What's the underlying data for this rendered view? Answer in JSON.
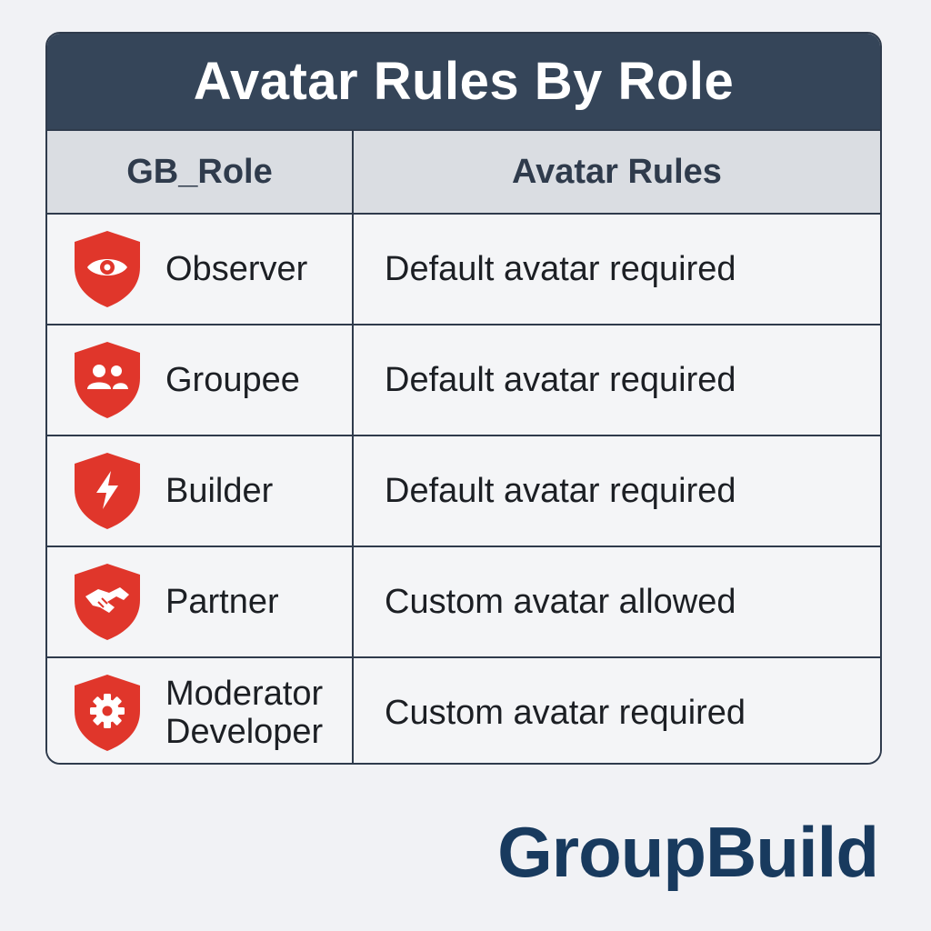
{
  "title": "Avatar Rules By Role",
  "columns": [
    "GB_Role",
    "Avatar Rules"
  ],
  "rows": [
    {
      "role": "Observer",
      "rule": "Default avatar required",
      "icon": "eye-icon"
    },
    {
      "role": "Groupee",
      "rule": "Default avatar required",
      "icon": "people-icon"
    },
    {
      "role": "Builder",
      "rule": "Default avatar required",
      "icon": "lightning-icon"
    },
    {
      "role": "Partner",
      "rule": "Custom avatar allowed",
      "icon": "handshake-icon"
    },
    {
      "role": "Moderator\nDeveloper",
      "rule": "Custom avatar required",
      "icon": "gear-icon"
    }
  ],
  "brand": "GroupBuild",
  "colors": {
    "header_bg": "#354559",
    "shield_red": "#e0362b",
    "brand_blue": "#183a5e"
  }
}
